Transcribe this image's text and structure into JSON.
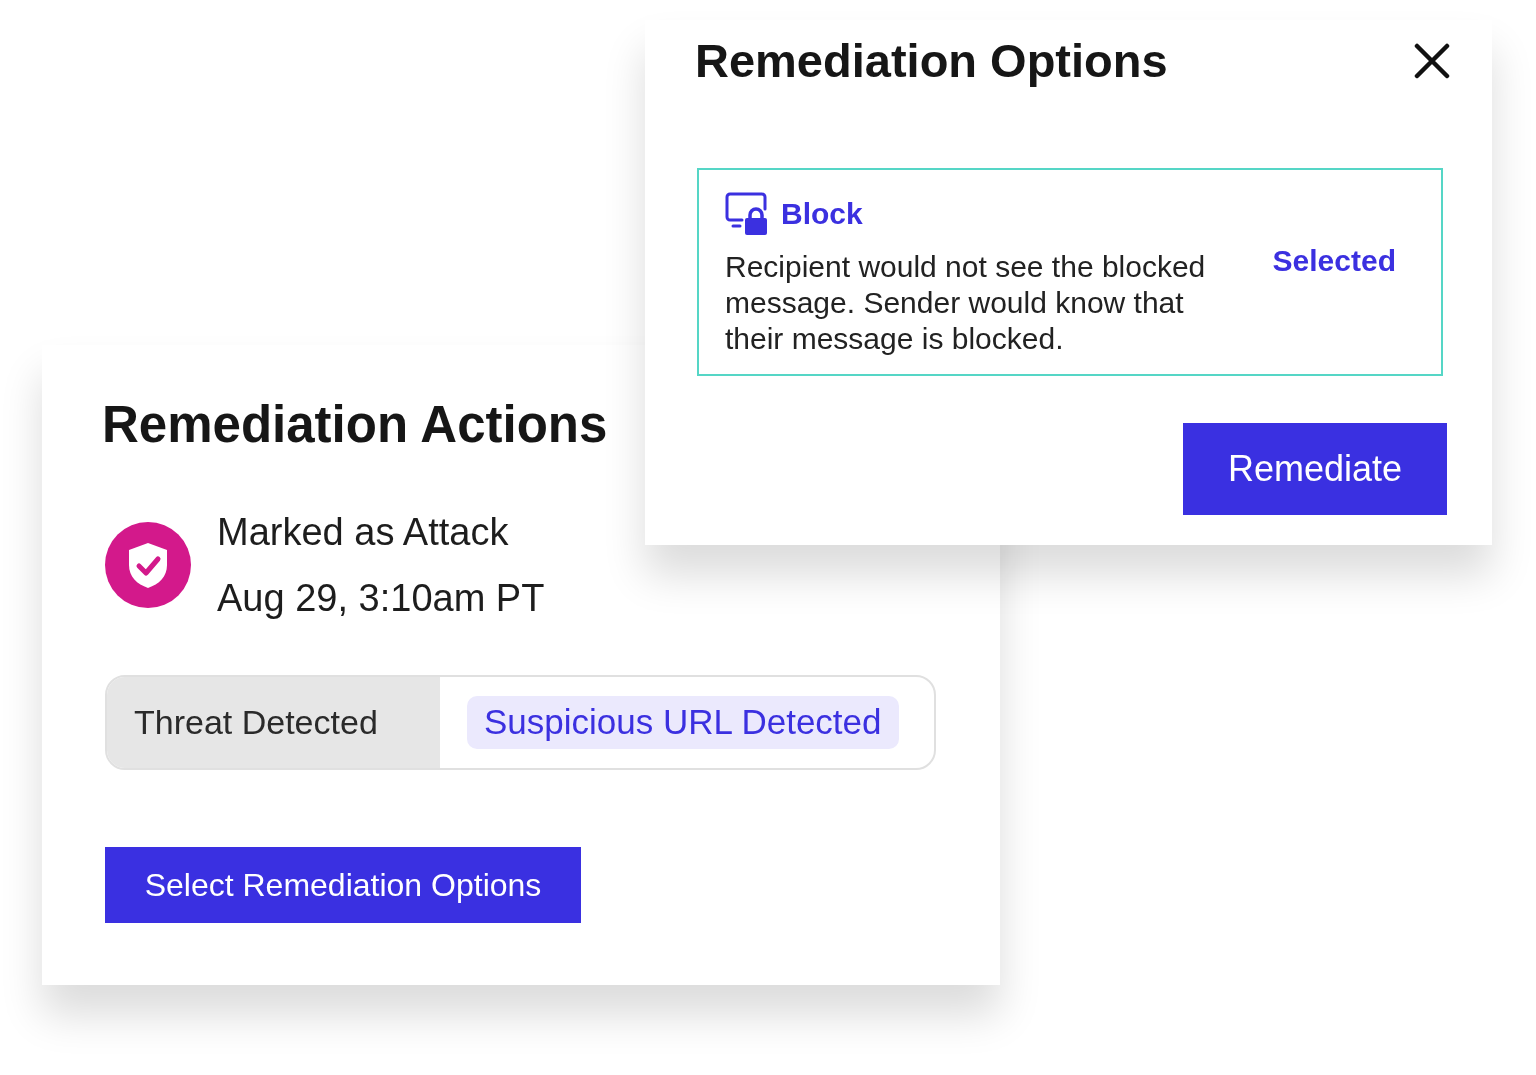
{
  "actions_card": {
    "title": "Remediation Actions",
    "event": {
      "title": "Marked as Attack",
      "timestamp": "Aug 29, 3:10am PT"
    },
    "threat": {
      "label": "Threat Detected",
      "value": "Suspicious URL Detected"
    },
    "button": "Select Remediation Options"
  },
  "options_dialog": {
    "title": "Remediation Options",
    "options": [
      {
        "kind": "block",
        "label": "Block",
        "description": "Recipient would not see the blocked message. Sender would know that their message is blocked.",
        "status": "Selected",
        "selected": true
      }
    ],
    "button": "Remediate"
  }
}
